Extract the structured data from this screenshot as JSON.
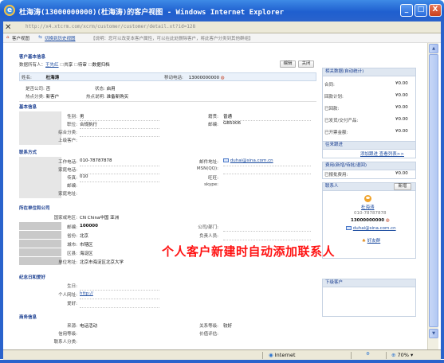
{
  "window": {
    "title": "杜海涛(13000000000)(杜海涛)的客户视图 - Windows Internet Explorer",
    "minimize": "_",
    "maximize": "□",
    "close": "X"
  },
  "address": {
    "url": "http://x4.xtcrm.com/xcrm/customer/customer/detail.xt?id=128"
  },
  "toolbar": {
    "view_label": "客户视图",
    "switch_label": "切换到历史视图",
    "hint": "【说明：您可以改变本客户属性，可以在此处删除客户，将此客户分类到其他群组】"
  },
  "basic": {
    "section_title": "客户基本信息",
    "creator_label": "数据所有人：",
    "creator_value": "王先红",
    "flags": [
      "共享",
      "待审",
      "数据归档"
    ],
    "edit_btn": "编辑",
    "delete_btn": "关闭"
  },
  "header_row": {
    "name_label": "姓名:",
    "name_value": "杜海涛",
    "mobile_label": "移动电话:",
    "mobile_value": "13000000000"
  },
  "overview": {
    "row1": [
      {
        "label": "是否公司:",
        "value": "否"
      },
      {
        "label": "状态:",
        "value": "启用"
      }
    ],
    "row2": [
      {
        "label": "热点分类:",
        "value": "新客户"
      },
      {
        "label": "热点说明:",
        "value": "准备新购买"
      }
    ]
  },
  "base_info": {
    "title": "基本信息",
    "left": [
      {
        "label": "性别:",
        "value": "男"
      },
      {
        "label": "职位:",
        "value": "合规执行"
      },
      {
        "label": "综合分类:",
        "value": ""
      },
      {
        "label": "上级客户:",
        "value": ""
      }
    ],
    "right": [
      {
        "label": "籍贯:",
        "value": "普通"
      },
      {
        "label": "邮编:",
        "value": "GB5006"
      }
    ]
  },
  "contact": {
    "title": "联系方式",
    "left": [
      {
        "label": "工作电话:",
        "value": "010-78787878"
      },
      {
        "label": "家庭电话:",
        "value": ""
      },
      {
        "label": "传真:",
        "value": "010"
      },
      {
        "label": "邮编:",
        "value": ""
      },
      {
        "label": "家庭地址:",
        "value": ""
      }
    ],
    "right": [
      {
        "label": "邮件地址:",
        "value": "duhai@sina.com.cn"
      },
      {
        "label": "MSN(QQ):",
        "value": ""
      },
      {
        "label": "旺旺:",
        "value": ""
      },
      {
        "label": "skype:",
        "value": ""
      }
    ]
  },
  "company": {
    "title": "所在单位和公司",
    "country_label": "国家或地区:",
    "country_value": "CN China中国 亚洲",
    "left": [
      {
        "label": "邮编:",
        "value": "100000"
      },
      {
        "label": "省份:",
        "value": "北京"
      },
      {
        "label": "城市:",
        "value": "市辖区"
      },
      {
        "label": "区县:",
        "value": "海淀区"
      },
      {
        "label": "单位地址:",
        "value": "北京市海淀区北京大学"
      }
    ],
    "right": [
      {
        "label": "公司/部门:",
        "value": ""
      },
      {
        "label": "负责人员:",
        "value": ""
      }
    ]
  },
  "memorial": {
    "title": "纪念日和爱好",
    "rows": [
      {
        "label": "生日:",
        "value": ""
      },
      {
        "label": "个人网址:",
        "value": "http://"
      },
      {
        "label": "爱好:",
        "value": ""
      }
    ]
  },
  "business": {
    "title": "商务信息",
    "left": [
      {
        "label": "来源:",
        "value": "电话活动"
      },
      {
        "label": "信用等级:",
        "value": ""
      },
      {
        "label": "联系人分类:",
        "value": ""
      }
    ],
    "right": [
      {
        "label": "关系等级:",
        "value": "较好"
      },
      {
        "label": "价值评估:",
        "value": ""
      }
    ]
  },
  "side": {
    "stats_title": "相关数据(自动统计)",
    "stats": [
      {
        "label": "合同:",
        "value": "¥0.00"
      },
      {
        "label": "回款计划:",
        "value": "¥0.00"
      },
      {
        "label": "已回款:",
        "value": "¥0.00"
      },
      {
        "label": "已发货/交付产品:",
        "value": "¥0.00"
      },
      {
        "label": "已开票金额:",
        "value": "¥0.00"
      }
    ],
    "follow_title": "往来跟进",
    "follow_link": "添加跟进  查看列表>>",
    "expense_title": "费用(新增/待批/退回)",
    "expense_label": "已报批费用:",
    "expense_value": "¥0.00",
    "contacts_title": "联系人",
    "contacts_btn": "新增",
    "contact_name": "杜海涛",
    "contact_phone": "010-78787878",
    "contact_mobile": "13000000000",
    "contact_email": "duhai@sina.com.cn",
    "contact_extra": "好友群",
    "sub_title": "下级客户"
  },
  "overlay_text": "个人客户新建时自动添加联系人",
  "status": {
    "zone": "Internet",
    "zoom": "70%"
  }
}
